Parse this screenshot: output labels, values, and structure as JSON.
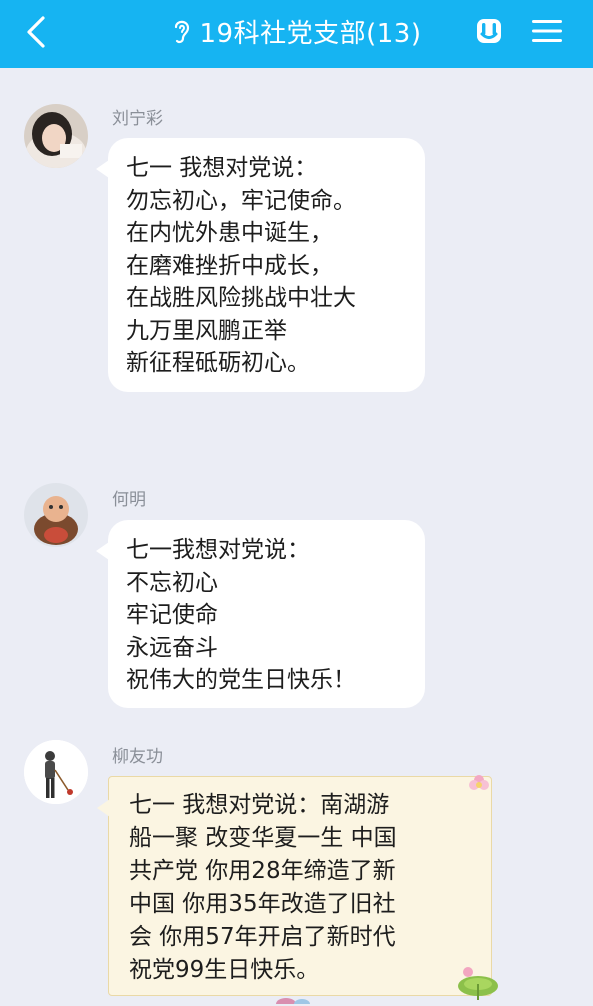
{
  "header": {
    "title": "19科社党支部(13)",
    "colors": {
      "bar": "#16b4f2",
      "text": "#ffffff"
    },
    "icons": [
      "back-arrow-icon",
      "ear-icon",
      "rock-hand-icon",
      "menu-icon"
    ]
  },
  "messages": [
    {
      "sender": "刘宁彩",
      "text": "七一 我想对党说：\n勿忘初心，牢记使命。\n在内忧外患中诞生，\n在磨难挫折中成长，\n在战胜风险挑战中壮大\n九万里风鹏正举\n新征程砥砺初心。",
      "avatar_icon": "woman-photo-avatar"
    },
    {
      "sender": "何明",
      "text": "七一我想对党说：\n不忘初心\n牢记使命\n永远奋斗\n祝伟大的党生日快乐！",
      "avatar_icon": "cartoon-figure-avatar"
    },
    {
      "sender": "柳友功",
      "text": "七一 我想对党说：南湖游\n船一聚  改变华夏一生 中国\n共产党 你用28年缔造了新\n中国 你用35年改造了旧社\n会 你用57年开启了新时代\n祝党99生日快乐。",
      "avatar_icon": "walking-man-avatar",
      "bubble_color": "#fbf5e2"
    }
  ]
}
